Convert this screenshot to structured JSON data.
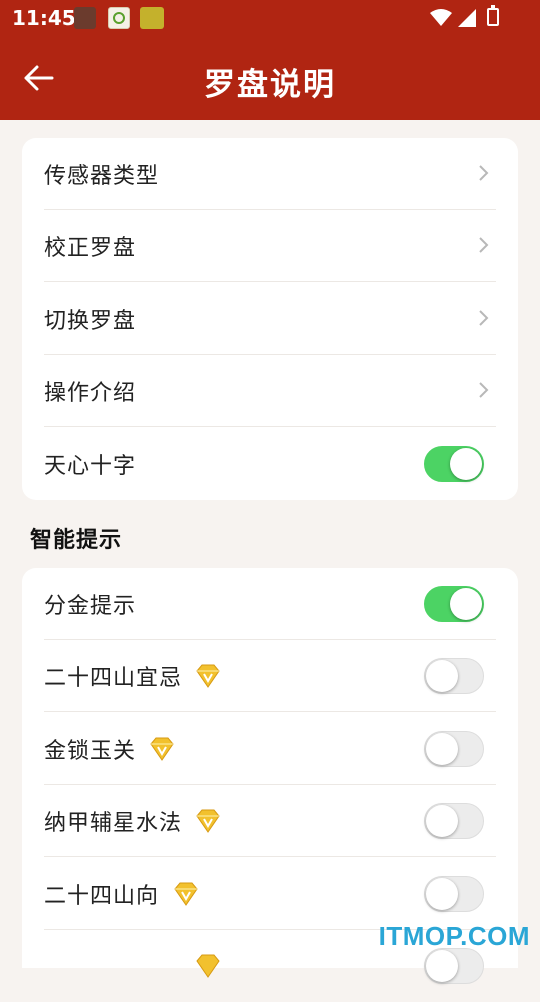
{
  "status_bar": {
    "time": "11:45"
  },
  "app_bar": {
    "title": "罗盘说明"
  },
  "settings_group": {
    "items": [
      {
        "label": "传感器类型",
        "type": "nav"
      },
      {
        "label": "校正罗盘",
        "type": "nav"
      },
      {
        "label": "切换罗盘",
        "type": "nav"
      },
      {
        "label": "操作介绍",
        "type": "nav"
      },
      {
        "label": "天心十字",
        "type": "toggle",
        "on": true
      }
    ]
  },
  "smart_tips": {
    "section_title": "智能提示",
    "items": [
      {
        "label": "分金提示",
        "vip": false,
        "on": true
      },
      {
        "label": "二十四山宜忌",
        "vip": true,
        "on": false
      },
      {
        "label": "金锁玉关",
        "vip": true,
        "on": false
      },
      {
        "label": "纳甲辅星水法",
        "vip": true,
        "on": false
      },
      {
        "label": "二十四山向",
        "vip": true,
        "on": false
      }
    ]
  },
  "watermark": "ITMOP.COM",
  "colors": {
    "primary": "#b02512",
    "toggle_on": "#4cd364",
    "background": "#f7f3f0"
  }
}
